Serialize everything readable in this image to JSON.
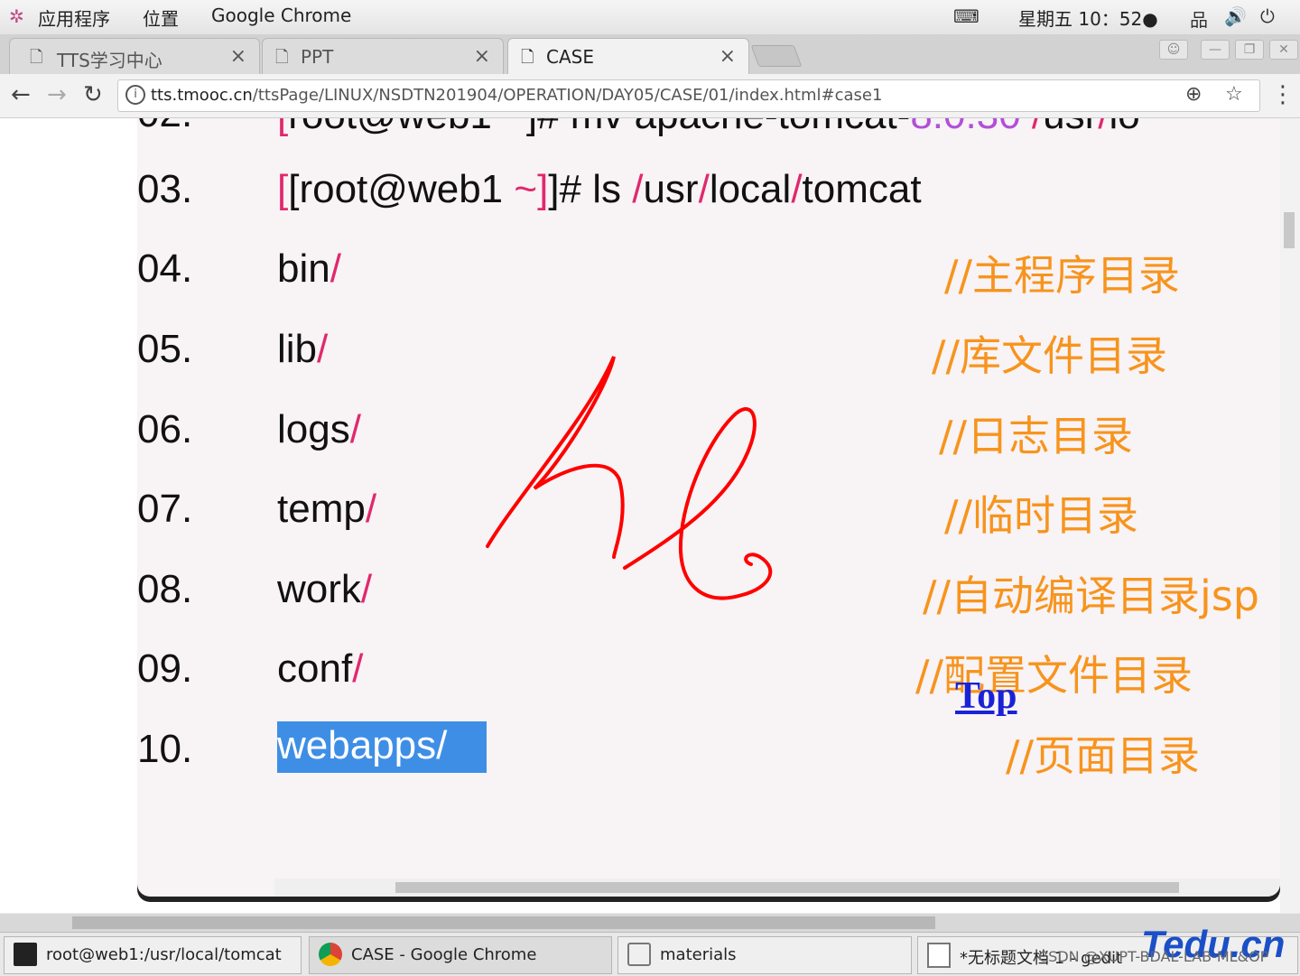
{
  "topbar": {
    "apps_label": "应用程序",
    "places_label": "位置",
    "app_name": "Google Chrome",
    "clock": "星期五 10：52●"
  },
  "tabs": [
    {
      "label": "TTS学习中心"
    },
    {
      "label": "PPT"
    },
    {
      "label": "CASE"
    }
  ],
  "address_bar": {
    "host": "tts.tmooc.cn",
    "path": "/ttsPage/LINUX/NSDTN201904/OPERATION/DAY05/CASE/01/index.html#case1"
  },
  "code": {
    "lines": [
      {
        "num": "03.",
        "prefix": "[root@web1 ",
        "tilde": "~",
        "rest": "]# ls ",
        "p1": "/",
        "a": "usr",
        "p2": "/",
        "b": "local",
        "p3": "/",
        "c": "tomcat"
      },
      {
        "num": "04.",
        "name": "bin",
        "slash": "/",
        "comment": "//主程序目录"
      },
      {
        "num": "05.",
        "name": "lib",
        "slash": "/",
        "comment": "//库文件目录"
      },
      {
        "num": "06.",
        "name": "logs",
        "slash": "/",
        "comment": "//日志目录"
      },
      {
        "num": "07.",
        "name": "temp",
        "slash": "/",
        "comment": "//临时目录"
      },
      {
        "num": "08.",
        "name": "work",
        "slash": "/",
        "comment": "//自动编译目录jsp"
      },
      {
        "num": "09.",
        "name": "conf",
        "slash": "/",
        "comment": "//配置文件目录"
      },
      {
        "num": "10.",
        "name": "webapps/",
        "comment": "//页面目录"
      }
    ],
    "top_link": "Top"
  },
  "taskbar": {
    "items": [
      {
        "label": "root@web1:/usr/local/tomcat"
      },
      {
        "label": "CASE - Google Chrome"
      },
      {
        "label": "materials"
      },
      {
        "label": "*无标题文档 1 - gedit"
      }
    ],
    "watermark": "CSDN @XUPT-BDAL-LAB-ML&OP",
    "logo": "Tedu.cn"
  },
  "colors": {
    "pink": "#e0286e",
    "orange": "#f7941d",
    "selection": "#3f8ee6",
    "ink": "#ff0000"
  }
}
